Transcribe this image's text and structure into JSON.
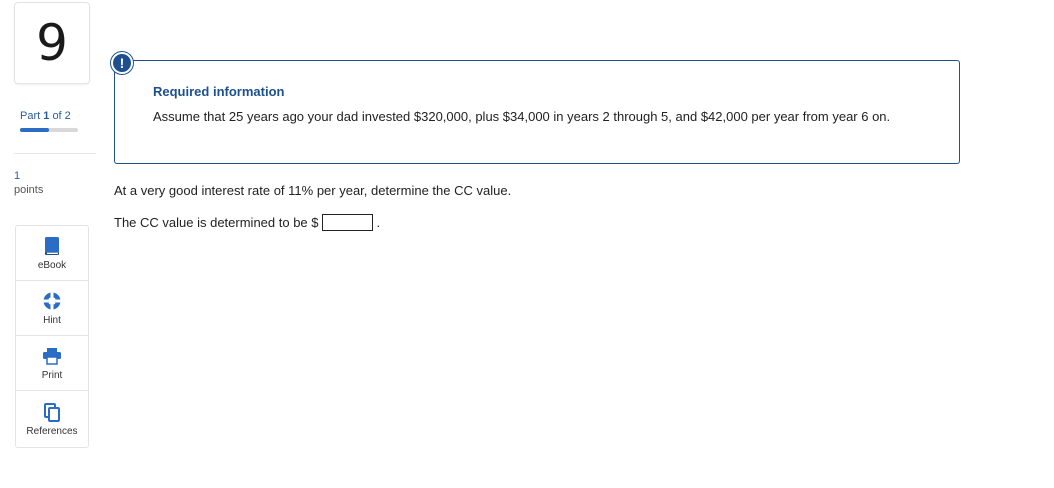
{
  "question": {
    "number": "9"
  },
  "part": {
    "prefix": "Part",
    "current": "1",
    "of_text": "of 2",
    "progress": 0.5
  },
  "points": {
    "value": "1",
    "label": "points"
  },
  "tools": [
    {
      "label": "eBook",
      "icon": "book-icon"
    },
    {
      "label": "Hint",
      "icon": "lifebuoy-icon"
    },
    {
      "label": "Print",
      "icon": "printer-icon"
    },
    {
      "label": "References",
      "icon": "documents-icon"
    }
  ],
  "info": {
    "badge": "!",
    "title": "Required information",
    "text": "Assume that 25 years ago your dad invested $320,000, plus $34,000 in years 2 through 5, and $42,000 per year from year 6 on."
  },
  "prompt": "At a very good interest rate of 11% per year, determine the CC value.",
  "answer": {
    "prefix": "The CC value is determined to be $",
    "value": "",
    "suffix": "."
  },
  "colors": {
    "accent": "#1d4f91",
    "progress": "#2b6cc4",
    "tool_icon": "#2b6cc4"
  }
}
